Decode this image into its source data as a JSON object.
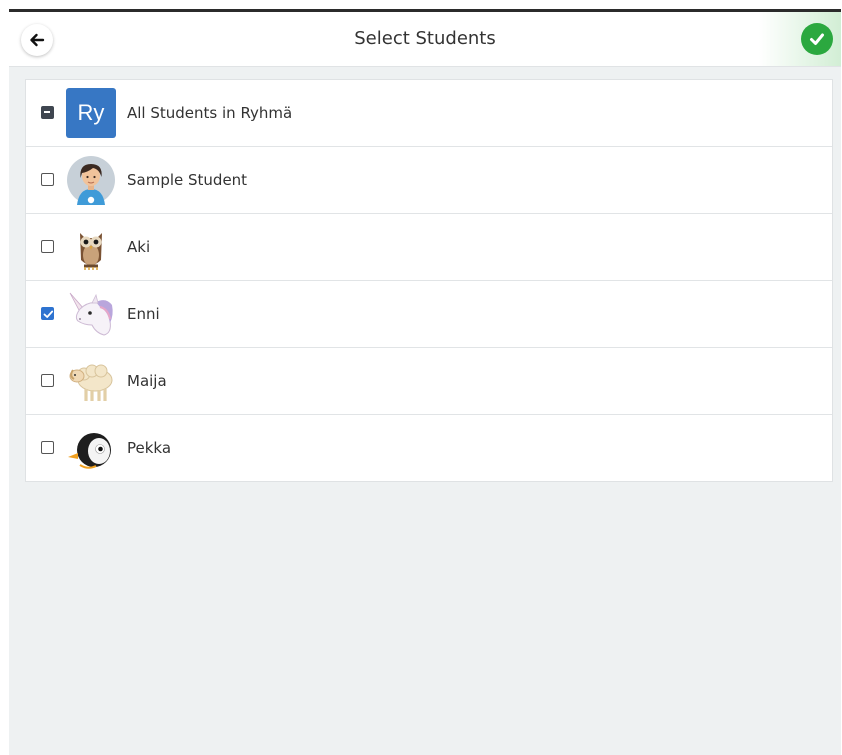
{
  "header": {
    "title": "Select Students",
    "back_icon": "arrow-left-icon",
    "confirm_icon": "check-circle-icon",
    "confirm_color": "#2ba83f"
  },
  "list": {
    "group": {
      "avatar_text": "Ry",
      "label": "All Students in Ryhmä",
      "state": "indeterminate",
      "avatar_color": "#3777c4"
    },
    "students": [
      {
        "name": "Sample Student",
        "avatar": "child-avatar-icon",
        "checked": false
      },
      {
        "name": "Aki",
        "avatar": "owl-icon",
        "checked": false
      },
      {
        "name": "Enni",
        "avatar": "unicorn-icon",
        "checked": true
      },
      {
        "name": "Maija",
        "avatar": "sheep-icon",
        "checked": false
      },
      {
        "name": "Pekka",
        "avatar": "penguin-icon",
        "checked": false
      }
    ]
  }
}
